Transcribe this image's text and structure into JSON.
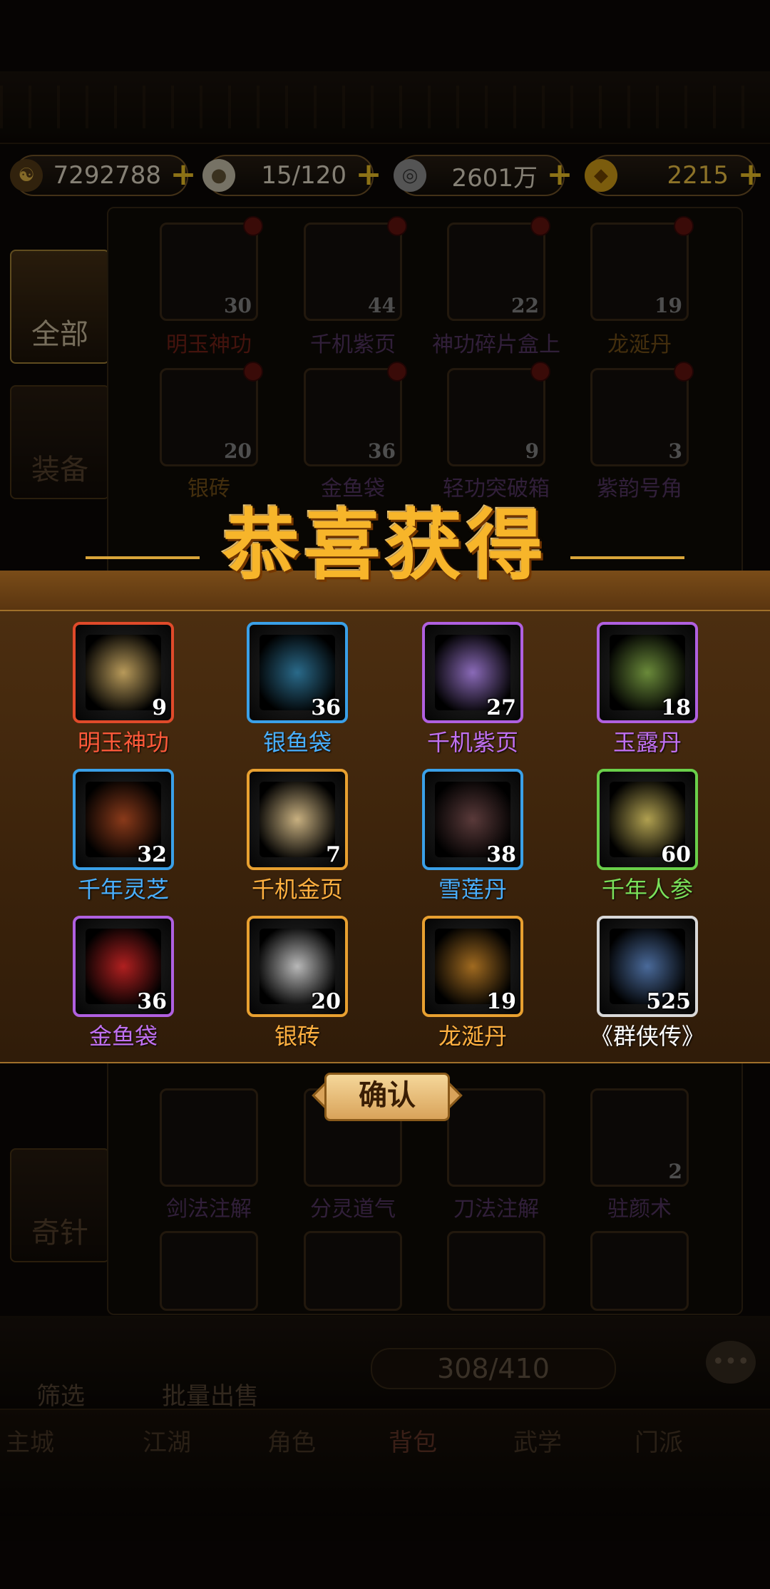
{
  "currency": [
    {
      "icon": "yin-yang-icon",
      "value": "7292788"
    },
    {
      "icon": "bun-icon",
      "value": "15/120"
    },
    {
      "icon": "coin-icon",
      "value": "2601万"
    },
    {
      "icon": "gold-ingot-icon",
      "value": "2215"
    }
  ],
  "side_tabs": [
    "全部",
    "装备",
    "奇针"
  ],
  "backpack_items": [
    {
      "name": "明玉神功",
      "count": "30",
      "color": "#c0392b"
    },
    {
      "name": "千机紫页",
      "count": "44",
      "color": "#9b59b6"
    },
    {
      "name": "神功碎片盒上",
      "count": "22",
      "color": "#9b59b6"
    },
    {
      "name": "龙涎丹",
      "count": "19",
      "color": "#d38a2a"
    },
    {
      "name": "银砖",
      "count": "20",
      "color": "#d38a2a"
    },
    {
      "name": "金鱼袋",
      "count": "36",
      "color": "#9b59b6"
    },
    {
      "name": "轻功突破箱",
      "count": "9",
      "color": "#9b59b6"
    },
    {
      "name": "紫韵号角",
      "count": "3",
      "color": "#9b59b6"
    }
  ],
  "backpack_items_lower": [
    {
      "name": "剑法注解",
      "count": ""
    },
    {
      "name": "分灵道气",
      "count": ""
    },
    {
      "name": "刀法注解",
      "count": ""
    },
    {
      "name": "驻颜术",
      "count": "2"
    }
  ],
  "dialog": {
    "title": "恭喜获得",
    "confirm_label": "确认",
    "rewards": [
      {
        "name": "明玉神功",
        "count": "9",
        "frame": "#e04a2a",
        "label_color": "#ff5a3a",
        "art": "#b89a5a"
      },
      {
        "name": "银鱼袋",
        "count": "36",
        "frame": "#3aa0e8",
        "label_color": "#4ab0ff",
        "art": "#2a6a8a"
      },
      {
        "name": "千机紫页",
        "count": "27",
        "frame": "#b060e0",
        "label_color": "#c070f0",
        "art": "#8a6ab8"
      },
      {
        "name": "玉露丹",
        "count": "18",
        "frame": "#b060e0",
        "label_color": "#c070f0",
        "art": "#6a8a3a"
      },
      {
        "name": "千年灵芝",
        "count": "32",
        "frame": "#3aa0e8",
        "label_color": "#4ab0ff",
        "art": "#8a3a1a"
      },
      {
        "name": "千机金页",
        "count": "7",
        "frame": "#e8a030",
        "label_color": "#ffb040",
        "art": "#c8b080"
      },
      {
        "name": "雪莲丹",
        "count": "38",
        "frame": "#3aa0e8",
        "label_color": "#4ab0ff",
        "art": "#5a3a3a"
      },
      {
        "name": "千年人参",
        "count": "60",
        "frame": "#6ad04a",
        "label_color": "#7ae05a",
        "art": "#b0a050"
      },
      {
        "name": "金鱼袋",
        "count": "36",
        "frame": "#b060e0",
        "label_color": "#c070f0",
        "art": "#b02020"
      },
      {
        "name": "银砖",
        "count": "20",
        "frame": "#e8a030",
        "label_color": "#ffb040",
        "art": "#b8b8b8"
      },
      {
        "name": "龙涎丹",
        "count": "19",
        "frame": "#e8a030",
        "label_color": "#ffb040",
        "art": "#a06a20"
      },
      {
        "name": "《群侠传》",
        "count": "525",
        "frame": "#d8d8d8",
        "label_color": "#ffffff",
        "art": "#4a6a9a"
      }
    ]
  },
  "utility": {
    "filter_label": "筛选",
    "bulk_sell_label": "批量出售",
    "bag_capacity": "308/410"
  },
  "nav": [
    "主城",
    "江湖",
    "角色",
    "背包",
    "武学",
    "门派"
  ]
}
